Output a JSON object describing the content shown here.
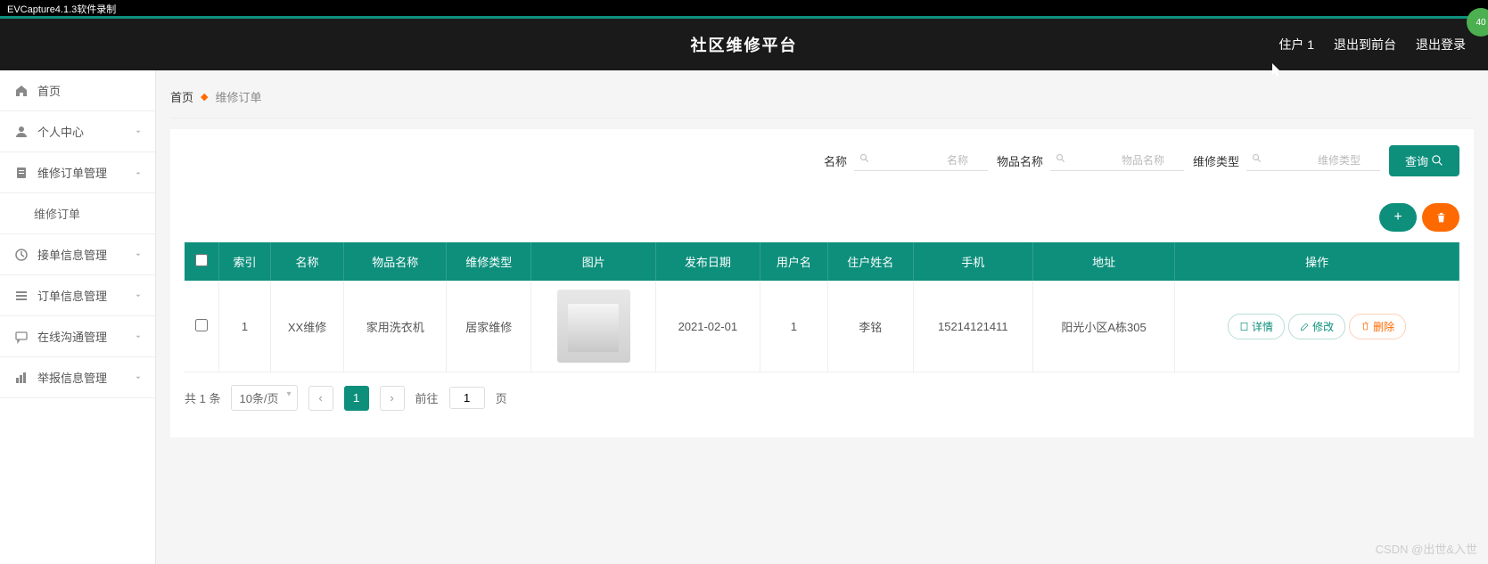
{
  "titlebar": "EVCapture4.1.3软件录制",
  "header": {
    "title": "社区维修平台",
    "user": "住户 1",
    "logout_front": "退出到前台",
    "logout": "退出登录",
    "avatar_text": "40"
  },
  "sidebar": [
    {
      "icon": "home",
      "label": "首页",
      "chev": null
    },
    {
      "icon": "user",
      "label": "个人中心",
      "chev": "down"
    },
    {
      "icon": "order",
      "label": "维修订单管理",
      "chev": "up"
    },
    {
      "icon": null,
      "label": "维修订单",
      "chev": null,
      "sub": true
    },
    {
      "icon": "clock",
      "label": "接单信息管理",
      "chev": "down"
    },
    {
      "icon": "list",
      "label": "订单信息管理",
      "chev": "down"
    },
    {
      "icon": "chat",
      "label": "在线沟通管理",
      "chev": "down"
    },
    {
      "icon": "chart",
      "label": "举报信息管理",
      "chev": "down"
    }
  ],
  "breadcrumb": {
    "home": "首页",
    "current": "维修订单"
  },
  "filters": [
    {
      "label": "名称",
      "placeholder": "名称"
    },
    {
      "label": "物品名称",
      "placeholder": "物品名称"
    },
    {
      "label": "维修类型",
      "placeholder": "维修类型"
    }
  ],
  "buttons": {
    "query": "查询"
  },
  "table": {
    "headers": [
      "",
      "索引",
      "名称",
      "物品名称",
      "维修类型",
      "图片",
      "发布日期",
      "用户名",
      "住户姓名",
      "手机",
      "地址",
      "操作"
    ],
    "rows": [
      {
        "index": "1",
        "name": "XX维修",
        "item": "家用洗衣机",
        "type": "居家维修",
        "date": "2021-02-01",
        "user": "1",
        "resident": "李铭",
        "phone": "15214121411",
        "address": "阳光小区A栋305"
      }
    ],
    "ops": {
      "detail": "详情",
      "edit": "修改",
      "delete": "删除"
    }
  },
  "pagination": {
    "total": "共 1 条",
    "per_page": "10条/页",
    "current": "1",
    "goto_prefix": "前往",
    "goto_value": "1",
    "goto_suffix": "页"
  },
  "watermark": "CSDN @出世&入世"
}
